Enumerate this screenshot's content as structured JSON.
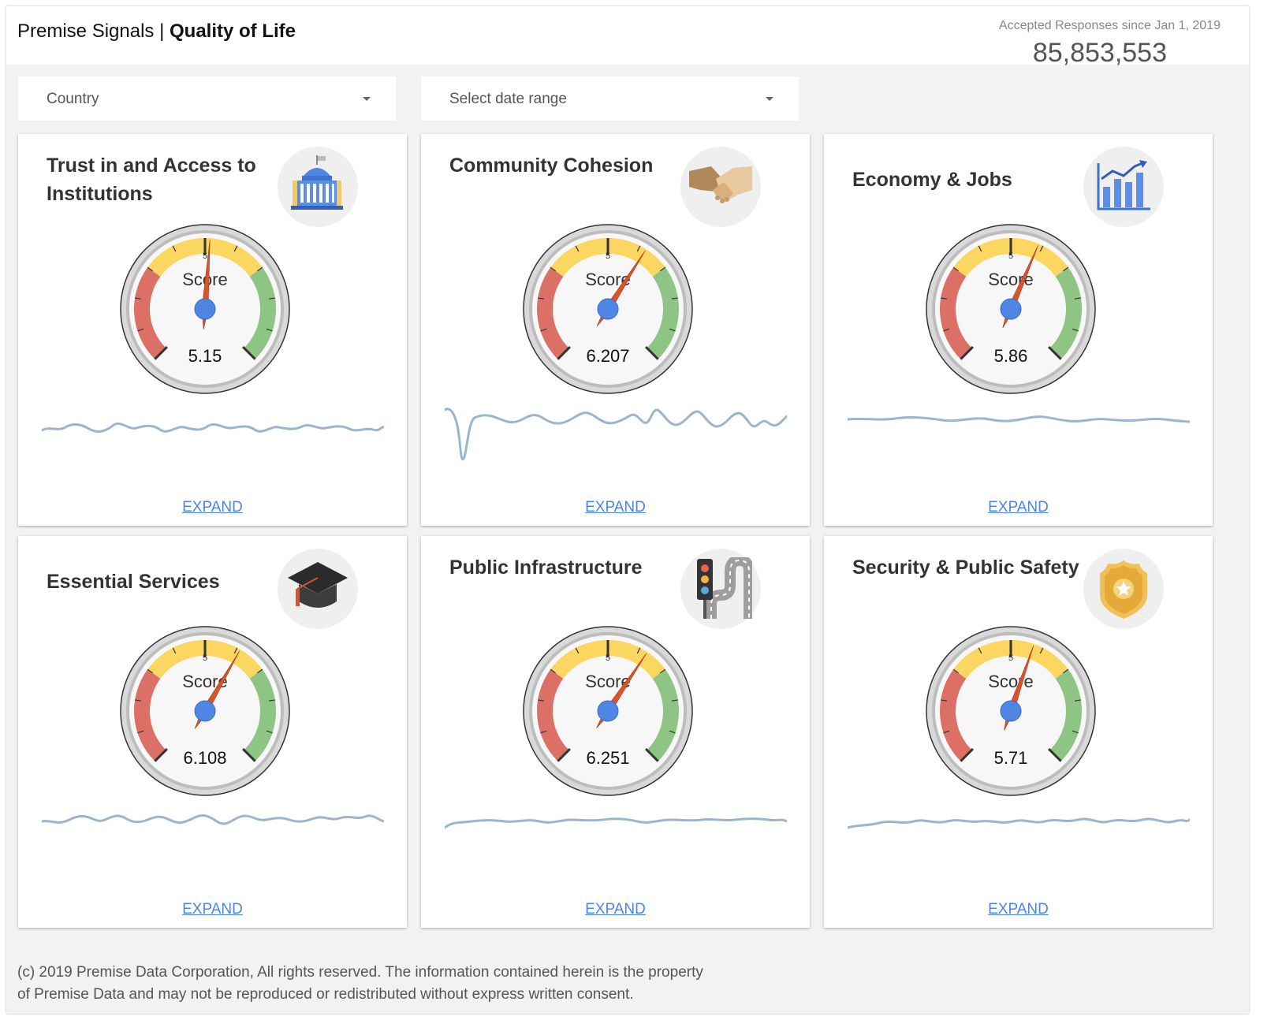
{
  "header": {
    "brand_prefix": "Premise Signals | ",
    "brand_bold": "Quality of Life",
    "responses_label": "Accepted Responses since Jan 1, 2019",
    "responses_count": "85,853,553"
  },
  "filters": {
    "country_label": "Country",
    "date_label": "Select date range"
  },
  "gauge_common": {
    "center_label": "Score",
    "mid_tick_label": "5",
    "scale_min": 0,
    "scale_max": 10
  },
  "cards": [
    {
      "title": "Trust in and Access to Institutions",
      "icon": "capitol-building-icon",
      "score": "5.15",
      "expand_label": "EXPAND"
    },
    {
      "title": "Community Cohesion",
      "icon": "handshake-icon",
      "score": "6.207",
      "expand_label": "EXPAND"
    },
    {
      "title": "Economy & Jobs",
      "icon": "bar-chart-trend-icon",
      "score": "5.86",
      "expand_label": "EXPAND"
    },
    {
      "title": "Essential Services",
      "icon": "graduation-cap-icon",
      "score": "6.108",
      "expand_label": "EXPAND"
    },
    {
      "title": "Public Infrastructure",
      "icon": "traffic-light-road-icon",
      "score": "6.251",
      "expand_label": "EXPAND"
    },
    {
      "title": "Security & Public Safety",
      "icon": "police-badge-icon",
      "score": "5.71",
      "expand_label": "EXPAND"
    }
  ],
  "colors": {
    "gauge_red": "#dc7067",
    "gauge_yellow": "#fbd660",
    "gauge_green": "#8fc584",
    "needle": "#d9542b",
    "hub": "#4f86e4",
    "sparkline": "#9bb5cc",
    "link": "#4a86e8"
  },
  "footer": {
    "line1": "(c) 2019 Premise Data Corporation, All rights reserved. The information contained herein is the property",
    "line2": "of Premise Data and may not be reproduced or redistributed without express written consent."
  }
}
